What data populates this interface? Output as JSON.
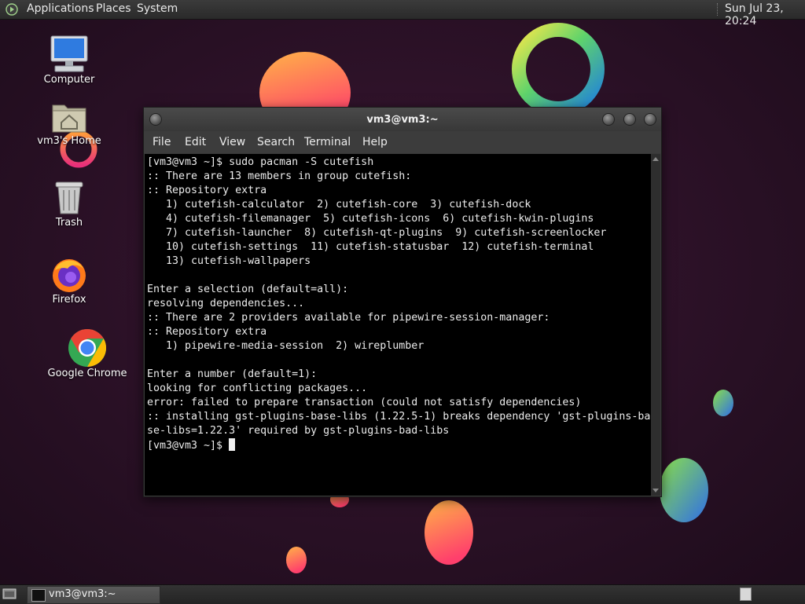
{
  "top_panel": {
    "menus": [
      "Applications",
      "Places",
      "System"
    ],
    "clock": "Sun Jul 23, 20:24"
  },
  "desktop": {
    "icons": [
      {
        "label": "Computer",
        "icon": "computer-icon"
      },
      {
        "label": "vm3's Home",
        "icon": "home-folder-icon"
      },
      {
        "label": "Trash",
        "icon": "trash-icon"
      },
      {
        "label": "Firefox",
        "icon": "firefox-icon"
      },
      {
        "label": "Google Chrome",
        "icon": "chrome-icon"
      }
    ]
  },
  "terminal": {
    "title": "vm3@vm3:~",
    "menu": [
      "File",
      "Edit",
      "View",
      "Search",
      "Terminal",
      "Help"
    ],
    "lines": [
      "[vm3@vm3 ~]$ sudo pacman -S cutefish",
      ":: There are 13 members in group cutefish:",
      ":: Repository extra",
      "   1) cutefish-calculator  2) cutefish-core  3) cutefish-dock",
      "   4) cutefish-filemanager  5) cutefish-icons  6) cutefish-kwin-plugins",
      "   7) cutefish-launcher  8) cutefish-qt-plugins  9) cutefish-screenlocker",
      "   10) cutefish-settings  11) cutefish-statusbar  12) cutefish-terminal",
      "   13) cutefish-wallpapers",
      "",
      "Enter a selection (default=all):",
      "resolving dependencies...",
      ":: There are 2 providers available for pipewire-session-manager:",
      ":: Repository extra",
      "   1) pipewire-media-session  2) wireplumber",
      "",
      "Enter a number (default=1):",
      "looking for conflicting packages...",
      "error: failed to prepare transaction (could not satisfy dependencies)",
      ":: installing gst-plugins-base-libs (1.22.5-1) breaks dependency 'gst-plugins-ba",
      "se-libs=1.22.3' required by gst-plugins-bad-libs"
    ],
    "prompt": "[vm3@vm3 ~]$ "
  },
  "taskbar": {
    "tasks": [
      {
        "label": "vm3@vm3:~",
        "icon": "terminal-icon",
        "active": true
      }
    ]
  },
  "colors": {
    "wallpaper_bg": "#250f22",
    "panel": "#2f2f2f",
    "terminal_bg": "#000000",
    "terminal_fg": "#ececec"
  }
}
